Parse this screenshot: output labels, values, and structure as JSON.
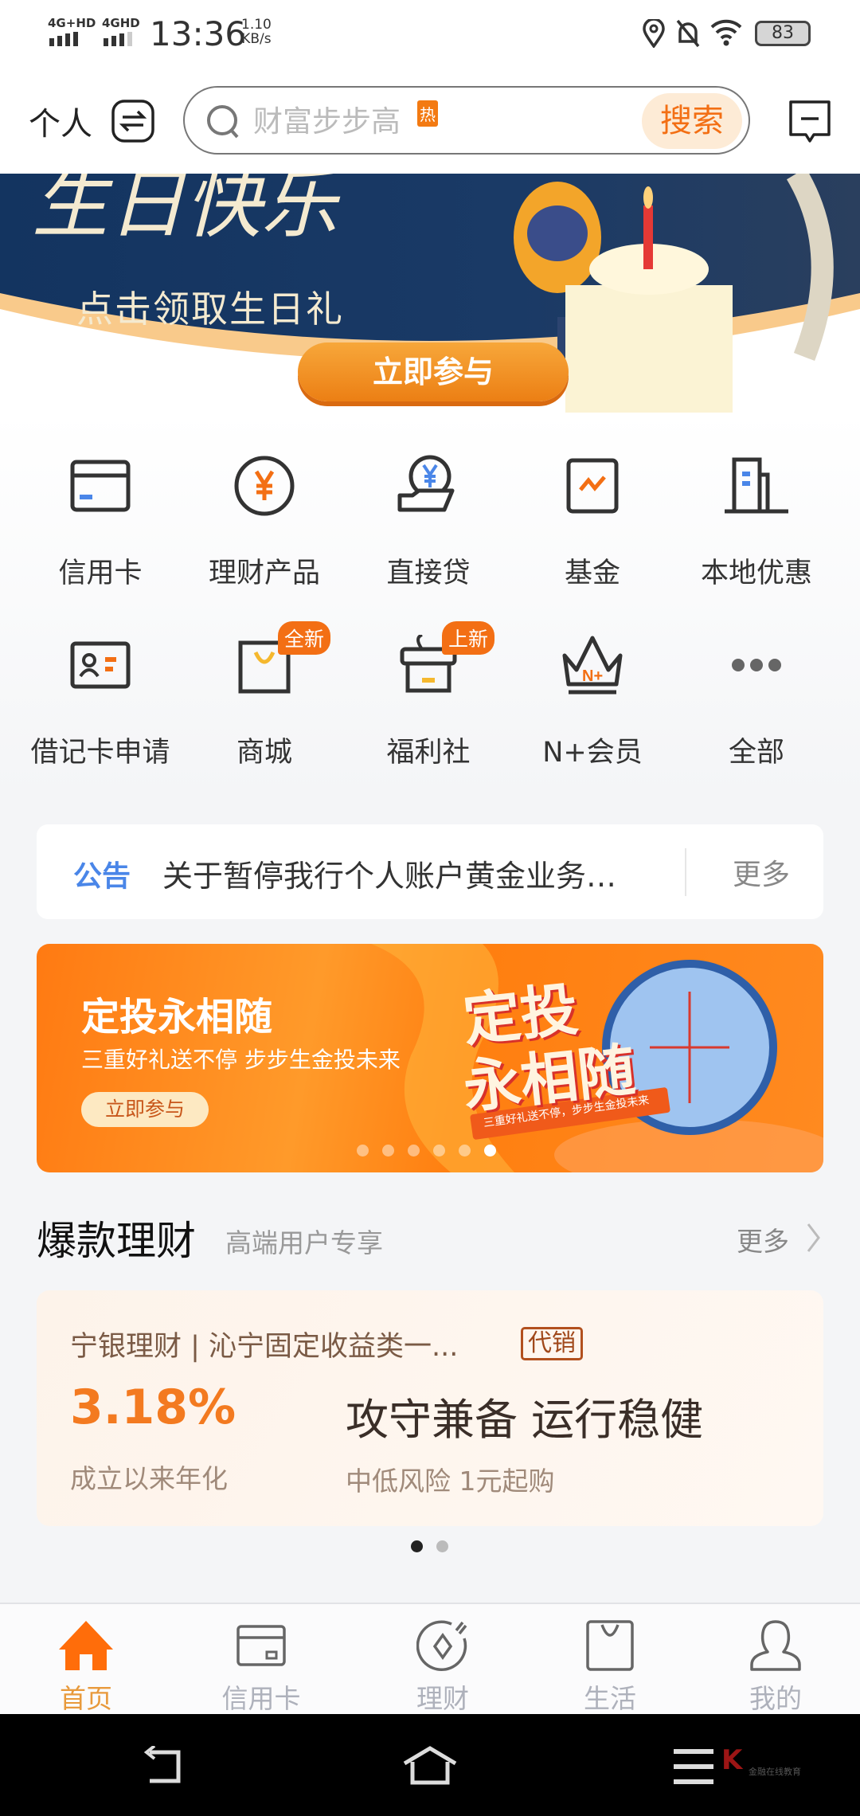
{
  "status_bar": {
    "network1": "4G+HD",
    "network2": "4GHD",
    "time": "13:36",
    "speed_value": "1.10",
    "speed_unit": "KB/s",
    "battery": "83"
  },
  "header": {
    "mode_label": "个人",
    "search_placeholder": "财富步步高",
    "hot_badge": "热",
    "search_button": "搜索"
  },
  "banner": {
    "title": "生日快乐",
    "subtitle": "点击领取生日礼",
    "cta": "立即参与"
  },
  "quick_menu": [
    {
      "label": "信用卡",
      "icon": "credit-card-icon"
    },
    {
      "label": "理财产品",
      "icon": "yuan-coin-icon"
    },
    {
      "label": "直接贷",
      "icon": "loan-hand-icon"
    },
    {
      "label": "基金",
      "icon": "fund-chart-icon"
    },
    {
      "label": "本地优惠",
      "icon": "building-icon"
    },
    {
      "label": "借记卡申请",
      "icon": "id-card-icon"
    },
    {
      "label": "商城",
      "icon": "shopping-bag-icon",
      "badge": "全新"
    },
    {
      "label": "福利社",
      "icon": "gift-box-icon",
      "badge": "上新"
    },
    {
      "label": "N+会员",
      "icon": "crown-icon"
    },
    {
      "label": "全部",
      "icon": "more-dots-icon"
    }
  ],
  "notice": {
    "tag": "公告",
    "text": "关于暂停我行个人账户黄金业务…",
    "more": "更多"
  },
  "promo": {
    "title": "定投永相随",
    "subtitle": "三重好礼送不停 步步生金投未来",
    "cta": "立即参与",
    "art_title_1": "定投",
    "art_title_2": "永相随",
    "art_ribbon": "三重好礼送不停，步步生金投未来",
    "slides": 6,
    "active_slide": 6
  },
  "hot_section": {
    "title": "爆款理财",
    "subtitle": "高端用户专享",
    "more": "更多"
  },
  "product": {
    "name": "宁银理财 | 沁宁固定收益类一...",
    "tag": "代销",
    "rate": "3.18%",
    "rate_label": "成立以来年化",
    "slogan": "攻守兼备 运行稳健",
    "details": "中低风险 1元起购",
    "pages": 2,
    "active_page": 1
  },
  "tabbar": [
    {
      "label": "首页",
      "active": true
    },
    {
      "label": "信用卡"
    },
    {
      "label": "理财"
    },
    {
      "label": "生活"
    },
    {
      "label": "我的"
    }
  ],
  "watermark": "金融在线教育",
  "colors": {
    "accent": "#f36f14",
    "notice_blue": "#4a86e8",
    "banner_navy": "#13335e"
  }
}
